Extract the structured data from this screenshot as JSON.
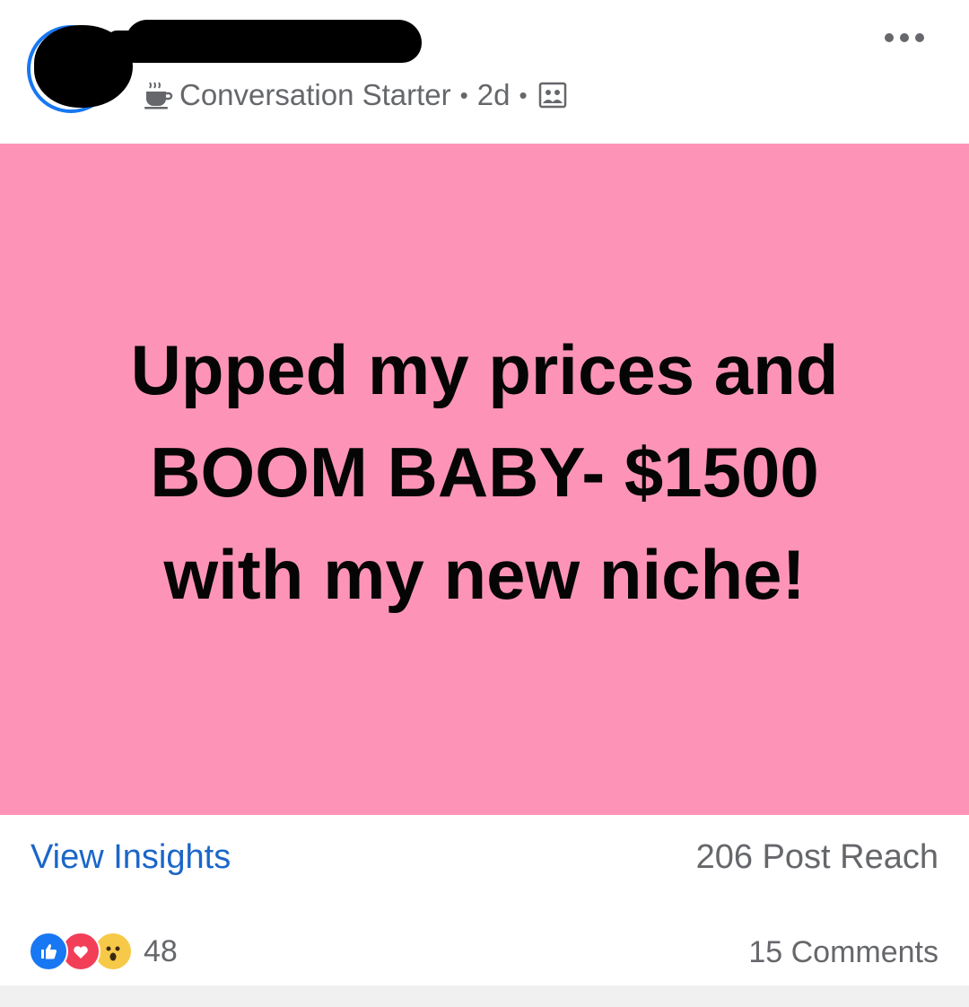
{
  "header": {
    "post_type_label": "Conversation Starter",
    "separator": "•",
    "time_ago": "2d",
    "post_type_icon": "coffee-cup-icon",
    "audience_icon": "group-members-icon",
    "more_icon": "more-options-icon"
  },
  "card": {
    "background_color": "#fd94b8",
    "text": "Upped my prices and BOOM BABY- $1500 with my new niche!"
  },
  "insights": {
    "link_label": "View Insights",
    "reach_label": "206 Post Reach"
  },
  "reactions": {
    "icons": [
      "like-icon",
      "love-icon",
      "wow-icon"
    ],
    "count": "48",
    "comments_label": "15 Comments"
  },
  "colors": {
    "link_blue": "#1b66c9",
    "secondary_text": "#65676b",
    "like_blue": "#1877f2",
    "love_red": "#f33e58",
    "wow_yellow": "#f7c948"
  }
}
